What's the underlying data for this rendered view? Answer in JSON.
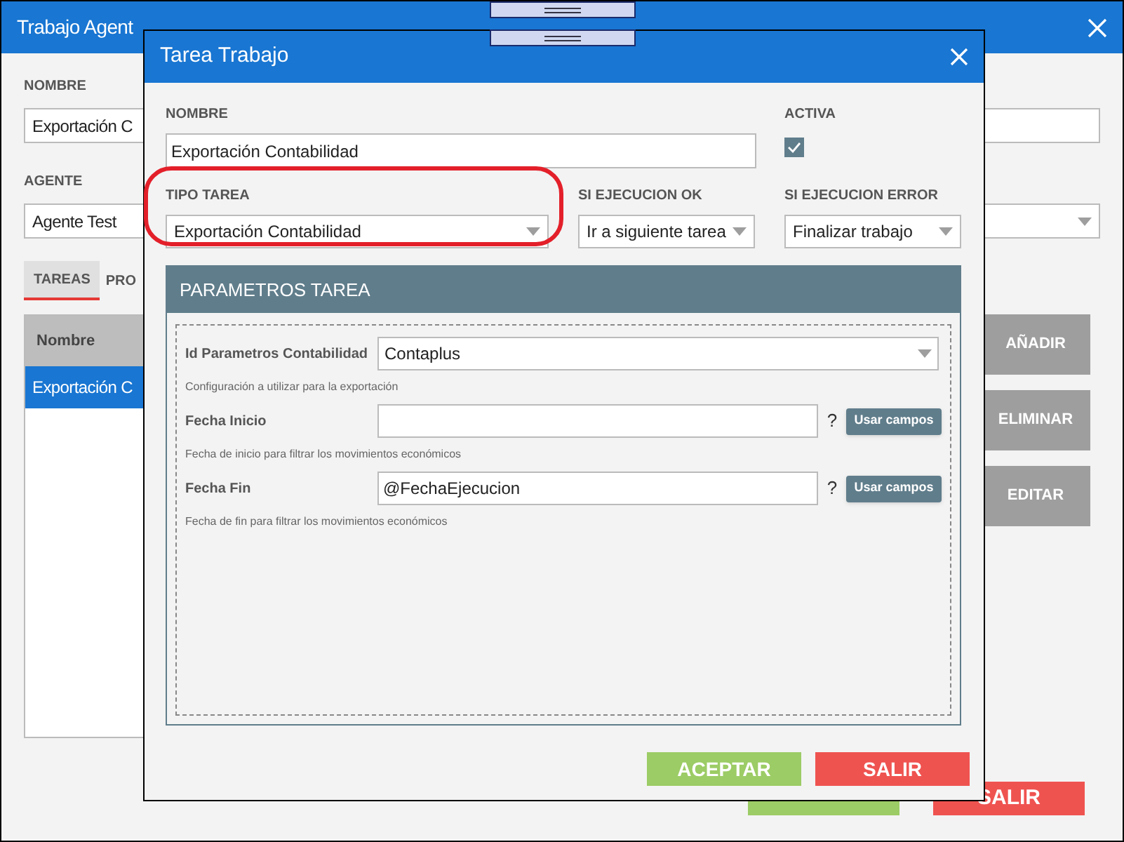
{
  "back_window": {
    "title": "Trabajo Agent",
    "fields": [
      {
        "label": "NOMBRE",
        "value": "Exportación C",
        "kind": "text"
      },
      {
        "label": "AGENTE",
        "value": "Agente Test",
        "kind": "select"
      }
    ],
    "tabs": [
      {
        "label": "TAREAS",
        "selected": true
      },
      {
        "label": "PRO",
        "selected": false
      }
    ],
    "table": {
      "columns": [
        "Nombre"
      ],
      "rows": [
        {
          "cells": [
            "Exportación C"
          ],
          "selected": true
        }
      ]
    },
    "side_buttons": [
      "AÑADIR",
      "ELIMINAR",
      "EDITAR"
    ],
    "footer_buttons": [
      {
        "kind": "accept"
      },
      {
        "kind": "exit",
        "label": "SALIR"
      }
    ]
  },
  "dialog": {
    "title": "Tarea Trabajo",
    "nombre": {
      "label": "NOMBRE",
      "value": "Exportación Contabilidad"
    },
    "activa": {
      "label": "ACTIVA",
      "checked": true
    },
    "selects": [
      {
        "label": "TIPO TAREA",
        "value": "Exportación Contabilidad",
        "highlighted": true
      },
      {
        "label": "SI EJECUCION OK",
        "value": "Ir a siguiente tarea",
        "highlighted": false
      },
      {
        "label": "SI EJECUCION ERROR",
        "value": "Finalizar trabajo",
        "highlighted": false
      }
    ],
    "panel": {
      "title": "PARAMETROS TAREA",
      "params": [
        {
          "kind": "select",
          "label": "Id Parametros Contabilidad",
          "value": "Contaplus",
          "hint": "Configuración a utilizar para la exportación"
        },
        {
          "kind": "text",
          "label": "Fecha Inicio",
          "help": "?",
          "button": "Usar campos",
          "hint": "Fecha de inicio para filtrar los movimientos económicos"
        },
        {
          "kind": "text",
          "label": "Fecha Fin",
          "value": "@FechaEjecucion",
          "help": "?",
          "button": "Usar campos",
          "hint": "Fecha de fin para filtrar los movimientos económicos"
        }
      ]
    },
    "buttons": [
      {
        "kind": "accept",
        "label": "ACEPTAR"
      },
      {
        "kind": "exit",
        "label": "SALIR"
      }
    ]
  }
}
